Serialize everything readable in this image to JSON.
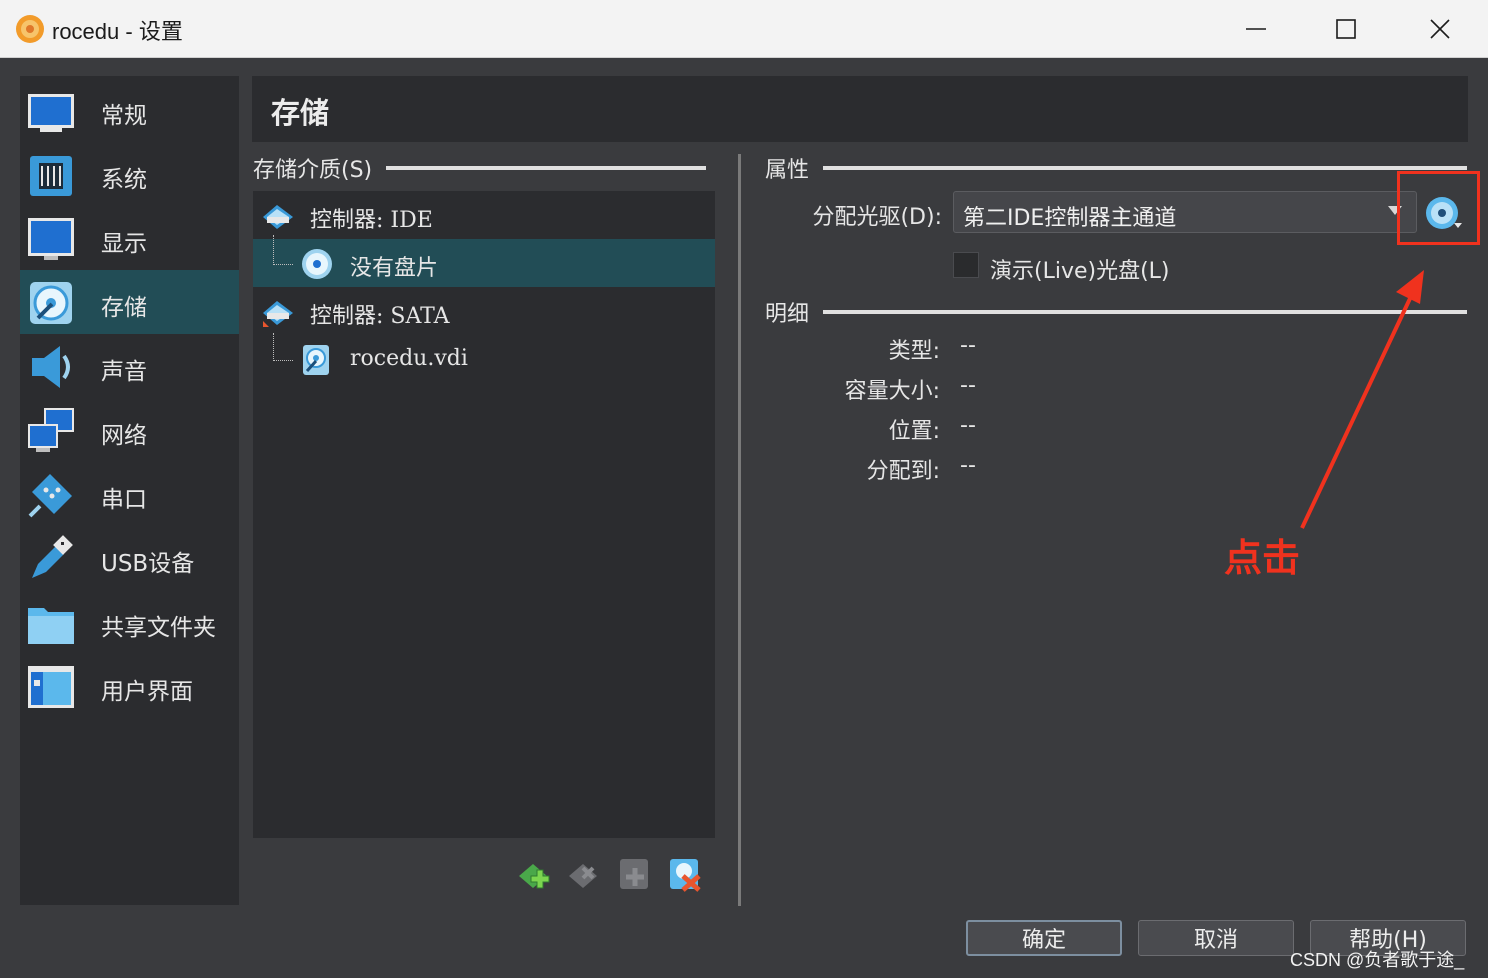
{
  "window": {
    "title": "rocedu - 设置",
    "minimize_icon": "minimize-icon",
    "maximize_icon": "maximize-icon",
    "close_icon": "close-icon"
  },
  "sidebar": {
    "items": [
      {
        "label": "常规",
        "icon": "monitor-icon"
      },
      {
        "label": "系统",
        "icon": "chip-icon"
      },
      {
        "label": "显示",
        "icon": "display-icon"
      },
      {
        "label": "存储",
        "icon": "storage-disc-icon",
        "active": true
      },
      {
        "label": "声音",
        "icon": "speaker-icon"
      },
      {
        "label": "网络",
        "icon": "network-icon"
      },
      {
        "label": "串口",
        "icon": "serial-port-icon"
      },
      {
        "label": "USB设备",
        "icon": "usb-icon"
      },
      {
        "label": "共享文件夹",
        "icon": "folder-icon"
      },
      {
        "label": "用户界面",
        "icon": "user-interface-icon"
      }
    ]
  },
  "header": {
    "title": "存储"
  },
  "storage": {
    "group_title": "存储介质(S)",
    "tree": [
      {
        "label": "控制器: IDE",
        "type": "controller"
      },
      {
        "label": "没有盘片",
        "type": "optical",
        "selected": true
      },
      {
        "label": "控制器: SATA",
        "type": "controller"
      },
      {
        "label": "rocedu.vdi",
        "type": "hard-disk"
      }
    ],
    "toolbar": [
      "add-controller-icon",
      "remove-controller-icon",
      "add-attachment-icon",
      "remove-attachment-icon"
    ]
  },
  "attributes": {
    "group_title": "属性",
    "drive_label": "分配光驱(D):",
    "drive_value": "第二IDE控制器主通道",
    "live_cd_label": "演示(Live)光盘(L)"
  },
  "details": {
    "group_title": "明细",
    "rows": [
      {
        "label": "类型:",
        "value": "--"
      },
      {
        "label": "容量大小:",
        "value": "--"
      },
      {
        "label": "位置:",
        "value": "--"
      },
      {
        "label": "分配到:",
        "value": "--"
      }
    ]
  },
  "annotation": {
    "text": "点击",
    "color": "#f0321e"
  },
  "buttons": {
    "ok": "确定",
    "cancel": "取消",
    "help": "帮助(H)"
  },
  "watermark": "CSDN @负者歌于途_",
  "colors": {
    "accent_selected": "#224d56",
    "panel_bg": "#2b2c2f",
    "window_bg": "#3a3b3e"
  }
}
